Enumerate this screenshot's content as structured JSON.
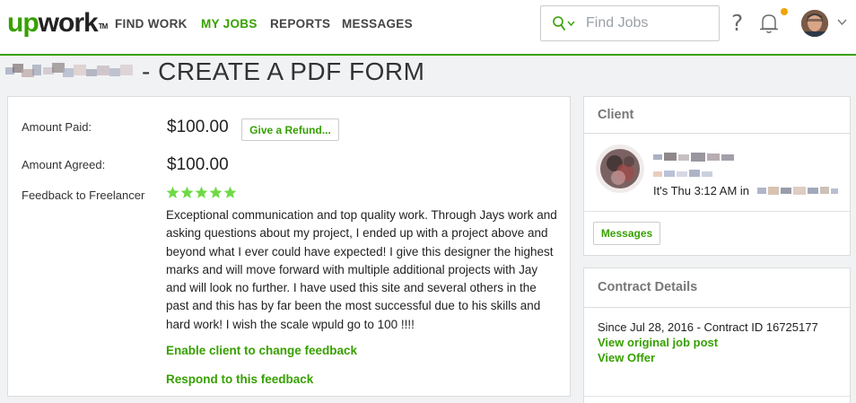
{
  "nav": {
    "logo_up": "up",
    "logo_work": "work",
    "logo_tm": "TM",
    "items": [
      {
        "label": "FIND WORK",
        "active": false
      },
      {
        "label": "MY JOBS",
        "active": true
      },
      {
        "label": "REPORTS",
        "active": false
      },
      {
        "label": "MESSAGES",
        "active": false
      }
    ],
    "search_placeholder": "Find Jobs",
    "help_label": "?",
    "notification_dot_color": "#f2a300"
  },
  "page": {
    "title_suffix": "- CREATE A PDF FORM"
  },
  "payment": {
    "amount_paid_label": "Amount Paid:",
    "amount_paid": "$100.00",
    "refund_button": "Give a Refund...",
    "amount_agreed_label": "Amount Agreed:",
    "amount_agreed": "$100.00",
    "feedback_label": "Feedback to Freelancer",
    "rating_stars": 5,
    "rating_max": 5,
    "feedback_text": "Exceptional communication and top quality work. Through Jays work and asking questions about my project, I ended up with a project above and beyond what I ever could have expected! I give this designer the highest marks and will move forward with multiple additional projects with Jay and will look no further. I have used this site and several others in the past and this has by far been the most successful due to his skills and hard work! I wish the scale wpuld go to 100 !!!!",
    "enable_change_link": "Enable client to change feedback",
    "respond_link": "Respond to this feedback"
  },
  "client": {
    "header": "Client",
    "local_time_prefix": "It's Thu 3:12 AM in",
    "messages_button": "Messages"
  },
  "contract": {
    "header": "Contract Details",
    "since_line": "Since Jul 28, 2016 - Contract ID 16725177",
    "view_job_post": "View original job post",
    "view_offer": "View Offer"
  },
  "colors": {
    "brand_green": "#37a000",
    "star_green": "#6fda44"
  }
}
